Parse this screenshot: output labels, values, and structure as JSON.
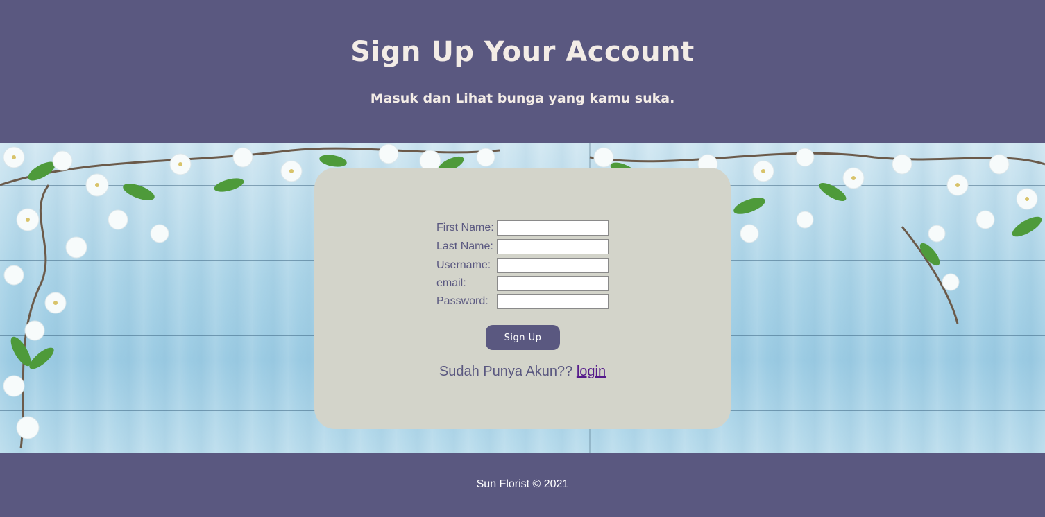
{
  "header": {
    "title": "Sign Up Your Account",
    "subtitle": "Masuk dan Lihat bunga yang kamu suka."
  },
  "form": {
    "fields": [
      {
        "label": "First Name:",
        "value": ""
      },
      {
        "label": "Last Name:",
        "value": ""
      },
      {
        "label": "Username:",
        "value": ""
      },
      {
        "label": "email:",
        "value": ""
      },
      {
        "label": "Password:",
        "value": ""
      }
    ],
    "submit_label": "Sign Up",
    "account_prompt": "Sudah Punya Akun??",
    "login_link": "login"
  },
  "footer": {
    "copyright": "Sun Florist © 2021"
  },
  "colors": {
    "primary": "#5a5880",
    "card": "#d3d4ca",
    "heading_text": "#f3ece6",
    "link": "#551a8b"
  },
  "icons": [
    "cherry-blossom-decoration"
  ]
}
